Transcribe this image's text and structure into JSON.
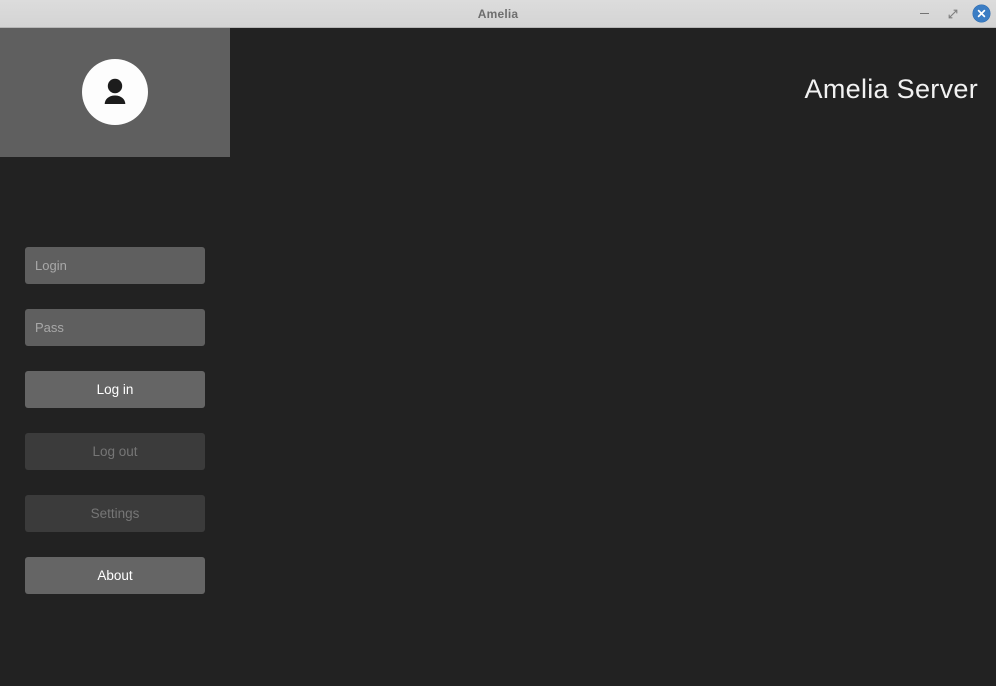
{
  "window": {
    "title": "Amelia",
    "titlebar_buttons": [
      {
        "name": "minimize-button",
        "glyph": "minimize-icon"
      },
      {
        "name": "maximize-button",
        "glyph": "maximize-icon"
      },
      {
        "name": "close-button",
        "glyph": "close-icon"
      }
    ],
    "close_button_color": "#3b7dc4"
  },
  "header": {
    "app_title": "Amelia Server",
    "avatar_icon": "user-avatar-icon",
    "panel_color": "#5f5f5f"
  },
  "theme": {
    "background": "#222222",
    "field_background": "#5f5f5f",
    "button_enabled_background": "#656565",
    "button_disabled_background": "#3b3b3b",
    "text_primary": "#ffffff",
    "text_disabled": "#767676",
    "placeholder": "#a8a8a8",
    "titlebar_background": "#d6d6d6",
    "titlebar_text": "#6e6e6e"
  },
  "form": {
    "login_field": {
      "value": "",
      "placeholder": "Login"
    },
    "pass_field": {
      "value": "",
      "placeholder": "Pass"
    }
  },
  "buttons": [
    {
      "label": "Log in",
      "enabled": true
    },
    {
      "label": "Log out",
      "enabled": false
    },
    {
      "label": "Settings",
      "enabled": false
    },
    {
      "label": "About",
      "enabled": true
    }
  ]
}
